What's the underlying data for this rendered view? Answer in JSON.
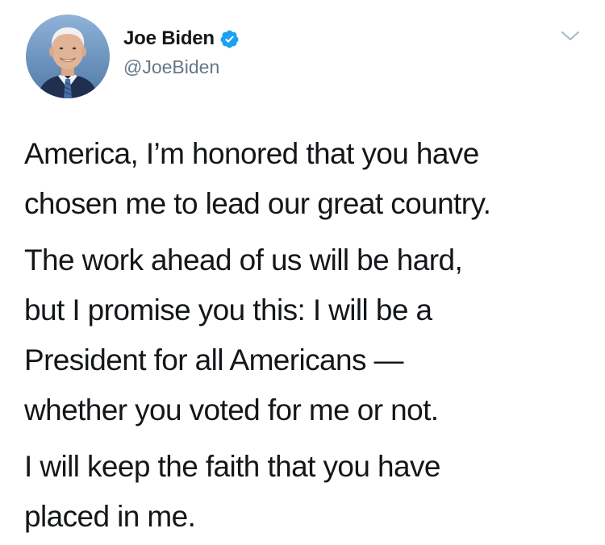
{
  "tweet": {
    "author": {
      "display_name": "Joe Biden",
      "handle": "@JoeBiden",
      "verified": true,
      "verified_icon": "verified-badge-icon",
      "avatar": "profile-photo"
    },
    "menu_icon": "chevron-down-icon",
    "paragraphs": [
      {
        "lines": [
          "America, I’m honored that you have",
          "chosen me to lead our great country."
        ]
      },
      {
        "lines": [
          "The work ahead of us will be hard,",
          "but I promise you this: I will be a",
          "President for all Americans —",
          "whether you voted for me or not."
        ]
      },
      {
        "lines": [
          "I will keep the faith that you have",
          "placed in me."
        ]
      }
    ]
  },
  "colors": {
    "text": "#14171a",
    "secondary_text": "#657786",
    "verified_blue": "#1da1f2",
    "caret_gray": "#aab8c2"
  }
}
